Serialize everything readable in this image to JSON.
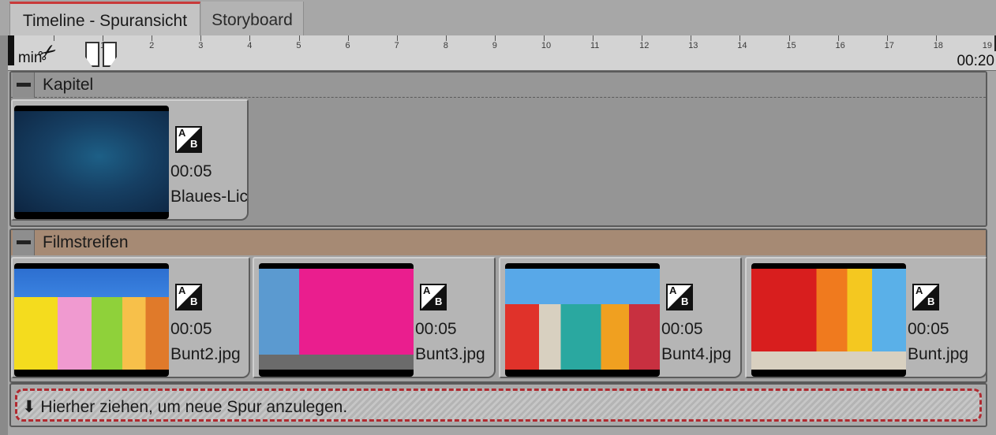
{
  "tabs": [
    {
      "label": "Timeline - Spuransicht",
      "active": true
    },
    {
      "label": "Storyboard",
      "active": false
    }
  ],
  "ruler": {
    "start_label": "0 min",
    "end_label": "00:20",
    "ticks": [
      "1",
      "2",
      "3",
      "4",
      "5",
      "6",
      "7",
      "8",
      "9",
      "10",
      "11",
      "12",
      "13",
      "14",
      "15",
      "16",
      "17",
      "18",
      "19"
    ]
  },
  "tracks": [
    {
      "title": "Kapitel",
      "header_color": "#979797",
      "clips": [
        {
          "duration": "00:05",
          "name": "Blaues-Licht.jpg",
          "transition_icon": "ab-transition-icon",
          "thumb": "blue-gradient"
        }
      ]
    },
    {
      "title": "Filmstreifen",
      "header_color": "#a68a74",
      "clips": [
        {
          "duration": "00:05",
          "name": "Bunt2.jpg",
          "transition_icon": "ab-transition-icon",
          "thumb": "colorful-houses"
        },
        {
          "duration": "00:05",
          "name": "Bunt3.jpg",
          "transition_icon": "ab-transition-icon",
          "thumb": "pink-blue-facade"
        },
        {
          "duration": "00:05",
          "name": "Bunt4.jpg",
          "transition_icon": "ab-transition-icon",
          "thumb": "canal-street"
        },
        {
          "duration": "00:05",
          "name": "Bunt.jpg",
          "transition_icon": "ab-transition-icon",
          "thumb": "red-doors"
        }
      ]
    }
  ],
  "new_track_hint": "⬇ Hierher ziehen, um neue Spur anzulegen.",
  "colors": {
    "accent": "#c83a3a",
    "drop_border": "#b02a30"
  }
}
